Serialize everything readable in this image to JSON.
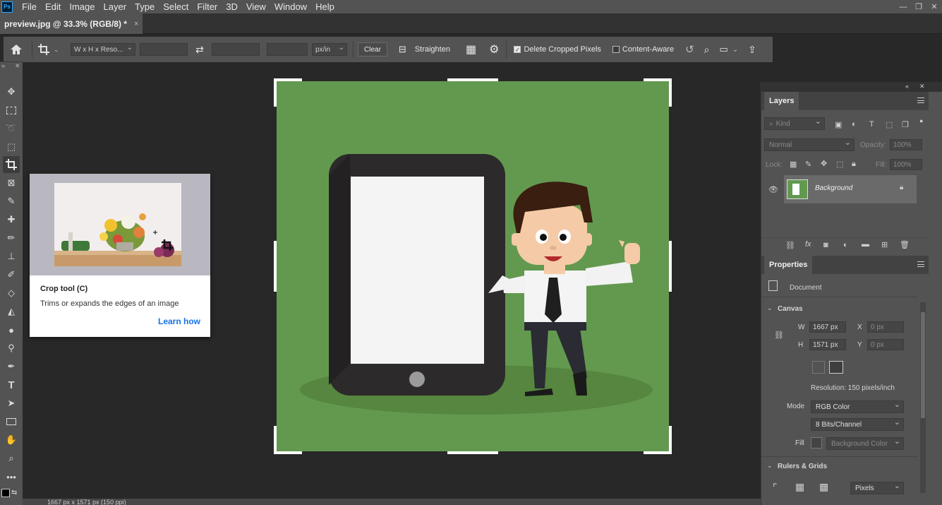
{
  "app": {
    "logo_text": "Ps"
  },
  "menu": [
    "File",
    "Edit",
    "Image",
    "Layer",
    "Type",
    "Select",
    "Filter",
    "3D",
    "View",
    "Window",
    "Help"
  ],
  "window_controls": {
    "minimize": "—",
    "restore": "❐",
    "close": "✕"
  },
  "document_tab": {
    "title": "preview.jpg @ 33.3% (RGB/8) *",
    "close": "×"
  },
  "options": {
    "ratio_preset": "W x H x Reso...",
    "width_value": "",
    "height_value": "",
    "resolution_value": "",
    "unit": "px/in",
    "clear_label": "Clear",
    "straighten_label": "Straighten",
    "delete_cropped_label": "Delete Cropped Pixels",
    "delete_cropped_checked": true,
    "content_aware_label": "Content-Aware",
    "content_aware_checked": false
  },
  "tooltip": {
    "title": "Crop tool (C)",
    "description": "Trims or expands the edges of an image",
    "link": "Learn how"
  },
  "layers_panel": {
    "tab": "Layers",
    "filter_kind": "Kind",
    "blend_mode": "Normal",
    "opacity_label": "Opacity:",
    "opacity_value": "100%",
    "lock_label": "Lock:",
    "fill_label": "Fill:",
    "fill_value": "100%",
    "layers": [
      {
        "name": "Background",
        "visible": true,
        "locked": true
      }
    ]
  },
  "properties_panel": {
    "tab": "Properties",
    "doc_label": "Document",
    "canvas_section": "Canvas",
    "w_label": "W",
    "w_value": "1667 px",
    "h_label": "H",
    "h_value": "1571 px",
    "x_label": "X",
    "x_value": "0 px",
    "y_label": "Y",
    "y_value": "0 px",
    "resolution": "Resolution: 150 pixels/inch",
    "mode_label": "Mode",
    "mode_value": "RGB Color",
    "bits_value": "8 Bits/Channel",
    "fill_label": "Fill",
    "fill_value": "Background Color",
    "rulers_section": "Rulers & Grids",
    "rulers_unit": "Pixels"
  },
  "status_bar": {
    "text": "1667 px x 1571 px (150 ppi)"
  },
  "colors": {
    "canvas_green": "#63994f",
    "accent_blue": "#1473e6"
  }
}
